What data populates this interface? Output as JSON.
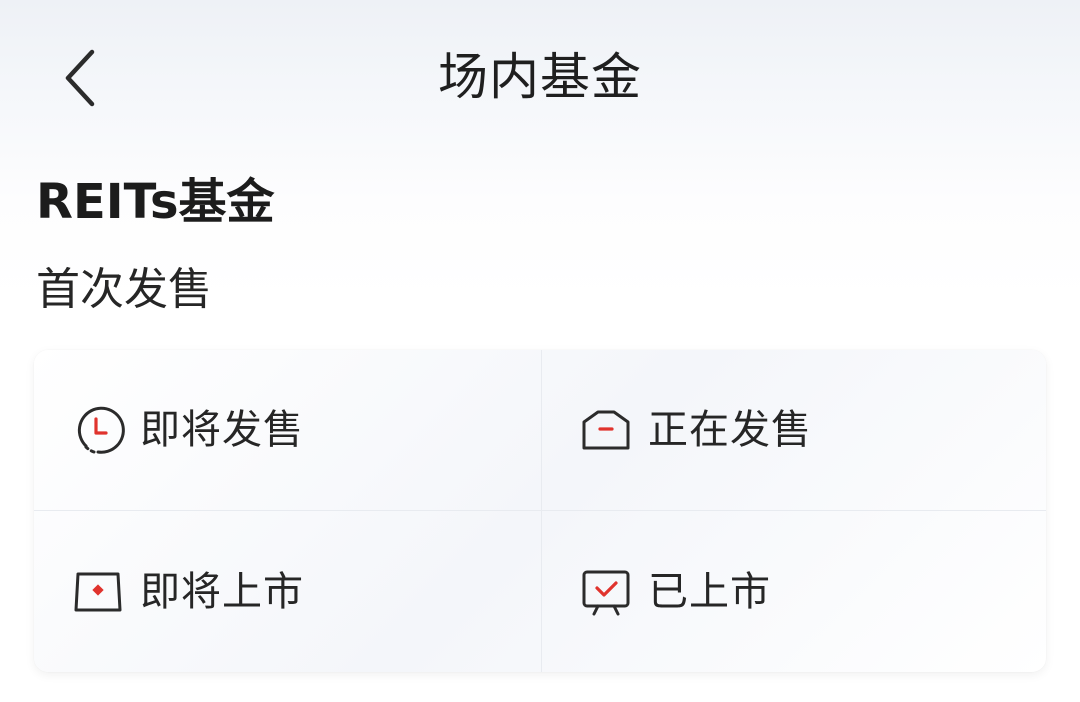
{
  "header": {
    "title": "场内基金",
    "back_icon": "chevron-left-icon"
  },
  "section": {
    "title": "REITs基金",
    "subtitle": "首次发售"
  },
  "grid": {
    "items": [
      {
        "label": "即将发售",
        "icon": "clock-icon"
      },
      {
        "label": "正在发售",
        "icon": "envelope-minus-icon"
      },
      {
        "label": "即将上市",
        "icon": "tray-dot-icon"
      },
      {
        "label": "已上市",
        "icon": "monitor-check-icon"
      }
    ]
  },
  "colors": {
    "accent": "#e0332d",
    "icon_stroke": "#2b2b2b",
    "text": "#262626",
    "divider": "#e8ebf0"
  }
}
